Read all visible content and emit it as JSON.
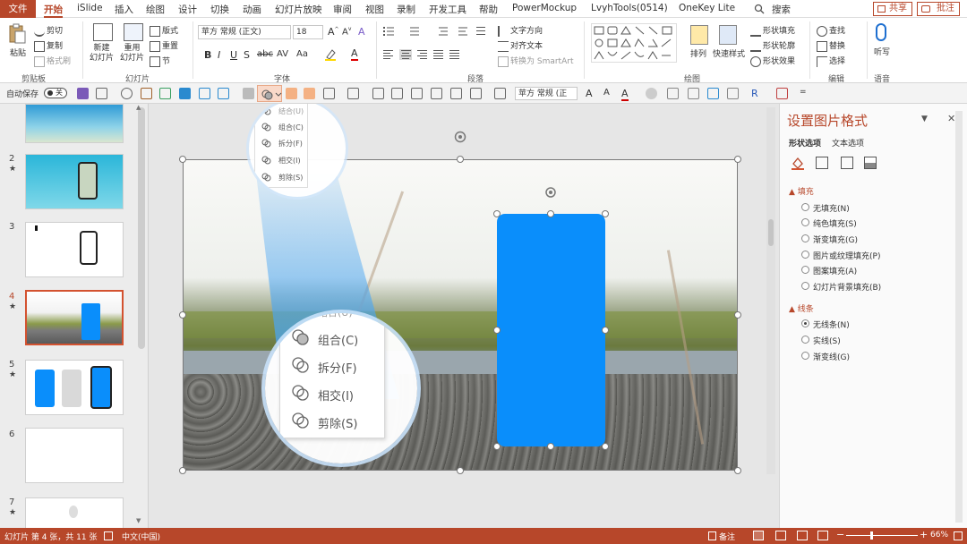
{
  "tabs": [
    "开始",
    "iSlide",
    "插入",
    "绘图",
    "设计",
    "切换",
    "动画",
    "幻灯片放映",
    "审阅",
    "视图",
    "录制",
    "开发工具",
    "帮助",
    "PowerMockup",
    "LvyhTools(0514)",
    "OneKey Lite"
  ],
  "file_tab": "文件",
  "search": "搜索",
  "share": "共享",
  "comment": "批注",
  "ribbon": {
    "clipboard": {
      "paste": "粘贴",
      "cut": "剪切",
      "copy": "复制",
      "format_painter": "格式刷",
      "label": "剪贴板"
    },
    "slides": {
      "new_slide": "新建\n幻灯片",
      "reuse": "重用\n幻灯片",
      "layout": "版式",
      "reset": "重置",
      "section": "节",
      "label": "幻灯片"
    },
    "font": {
      "name": "苹方 常规 (正文)",
      "size": "18",
      "label": "字体"
    },
    "paragraph": {
      "text_dir": "文字方向",
      "align_text": "对齐文本",
      "smartart": "转换为 SmartArt",
      "label": "段落"
    },
    "drawing": {
      "arrange": "排列",
      "quick_styles": "快速样式",
      "fill": "形状填充",
      "outline": "形状轮廓",
      "effects": "形状效果",
      "label": "绘图"
    },
    "editing": {
      "find": "查找",
      "replace": "替换",
      "select": "选择",
      "label": "编辑"
    },
    "voice": {
      "dictate": "听写",
      "label": "语音"
    }
  },
  "qat": {
    "autosave": "自动保存",
    "toggle": "关",
    "font": "苹方 常规 (正"
  },
  "merge_menu": {
    "items": [
      "组合(C)",
      "拆分(F)",
      "相交(I)",
      "剪除(S)"
    ],
    "partial": "结合(U)"
  },
  "slides": [
    {
      "num": "",
      "star": ""
    },
    {
      "num": "2",
      "star": "★"
    },
    {
      "num": "3",
      "star": ""
    },
    {
      "num": "4",
      "star": "★"
    },
    {
      "num": "5",
      "star": "★"
    },
    {
      "num": "6",
      "star": ""
    },
    {
      "num": "7",
      "star": "★"
    }
  ],
  "pane": {
    "title": "设置图片格式",
    "tab_shape": "形状选项",
    "tab_text": "文本选项",
    "fill_section": "填充",
    "fill_options": [
      "无填充(N)",
      "纯色填充(S)",
      "渐变填充(G)",
      "图片或纹理填充(P)",
      "图案填充(A)",
      "幻灯片背景填充(B)"
    ],
    "line_section": "线条",
    "line_options": [
      "无线条(N)",
      "实线(S)",
      "渐变线(G)"
    ]
  },
  "status": {
    "slide_info": "幻灯片 第 4 张，共 11 张",
    "lang": "中文(中国)",
    "notes": "备注",
    "zoom": "66%"
  },
  "colors": {
    "accent": "#b7472a",
    "shape": "#0a8efb",
    "zoom_circle": "#4aa6f4"
  }
}
